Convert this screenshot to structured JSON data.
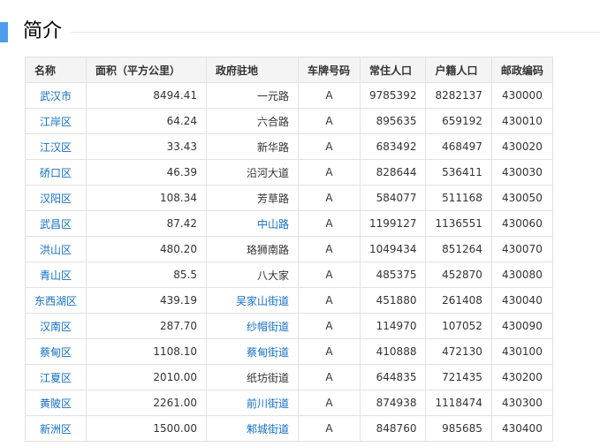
{
  "section": {
    "title": "简介"
  },
  "table": {
    "headers": [
      "名称",
      "面积（平方公里）",
      "政府驻地",
      "车牌号码",
      "常住人口",
      "户籍人口",
      "邮政编码"
    ],
    "rows": [
      {
        "name": "武汉市",
        "area": "8494.41",
        "gov": "一元路",
        "gov_link": false,
        "plate": "A",
        "resident": "9785392",
        "registered": "8282137",
        "postal": "430000"
      },
      {
        "name": "江岸区",
        "area": "64.24",
        "gov": "六合路",
        "gov_link": false,
        "plate": "A",
        "resident": "895635",
        "registered": "659192",
        "postal": "430010"
      },
      {
        "name": "江汉区",
        "area": "33.43",
        "gov": "新华路",
        "gov_link": false,
        "plate": "A",
        "resident": "683492",
        "registered": "468497",
        "postal": "430020"
      },
      {
        "name": "硚口区",
        "area": "46.39",
        "gov": "沿河大道",
        "gov_link": false,
        "plate": "A",
        "resident": "828644",
        "registered": "536411",
        "postal": "430030"
      },
      {
        "name": "汉阳区",
        "area": "108.34",
        "gov": "芳草路",
        "gov_link": false,
        "plate": "A",
        "resident": "584077",
        "registered": "511168",
        "postal": "430050"
      },
      {
        "name": "武昌区",
        "area": "87.42",
        "gov": "中山路",
        "gov_link": true,
        "plate": "A",
        "resident": "1199127",
        "registered": "1136551",
        "postal": "430060"
      },
      {
        "name": "洪山区",
        "area": "480.20",
        "gov": "珞狮南路",
        "gov_link": false,
        "plate": "A",
        "resident": "1049434",
        "registered": "851264",
        "postal": "430070"
      },
      {
        "name": "青山区",
        "area": "85.5",
        "gov": "八大家",
        "gov_link": false,
        "plate": "A",
        "resident": "485375",
        "registered": "452870",
        "postal": "430080"
      },
      {
        "name": "东西湖区",
        "area": "439.19",
        "gov": "吴家山街道",
        "gov_link": true,
        "plate": "A",
        "resident": "451880",
        "registered": "261408",
        "postal": "430040"
      },
      {
        "name": "汉南区",
        "area": "287.70",
        "gov": "纱帽街道",
        "gov_link": true,
        "plate": "A",
        "resident": "114970",
        "registered": "107052",
        "postal": "430090"
      },
      {
        "name": "蔡甸区",
        "area": "1108.10",
        "gov": "蔡甸街道",
        "gov_link": true,
        "plate": "A",
        "resident": "410888",
        "registered": "472130",
        "postal": "430100"
      },
      {
        "name": "江夏区",
        "area": "2010.00",
        "gov": "纸坊街道",
        "gov_link": false,
        "plate": "A",
        "resident": "644835",
        "registered": "721435",
        "postal": "430200"
      },
      {
        "name": "黄陂区",
        "area": "2261.00",
        "gov": "前川街道",
        "gov_link": true,
        "plate": "A",
        "resident": "874938",
        "registered": "1118474",
        "postal": "430300"
      },
      {
        "name": "新洲区",
        "area": "1500.00",
        "gov": "邾城街道",
        "gov_link": true,
        "plate": "A",
        "resident": "848760",
        "registered": "985685",
        "postal": "430400"
      }
    ]
  },
  "colors": {
    "accent": "#4f9cee",
    "link": "#136ec2",
    "header_bg": "#f4f4f4",
    "border": "#e2e2e2"
  }
}
